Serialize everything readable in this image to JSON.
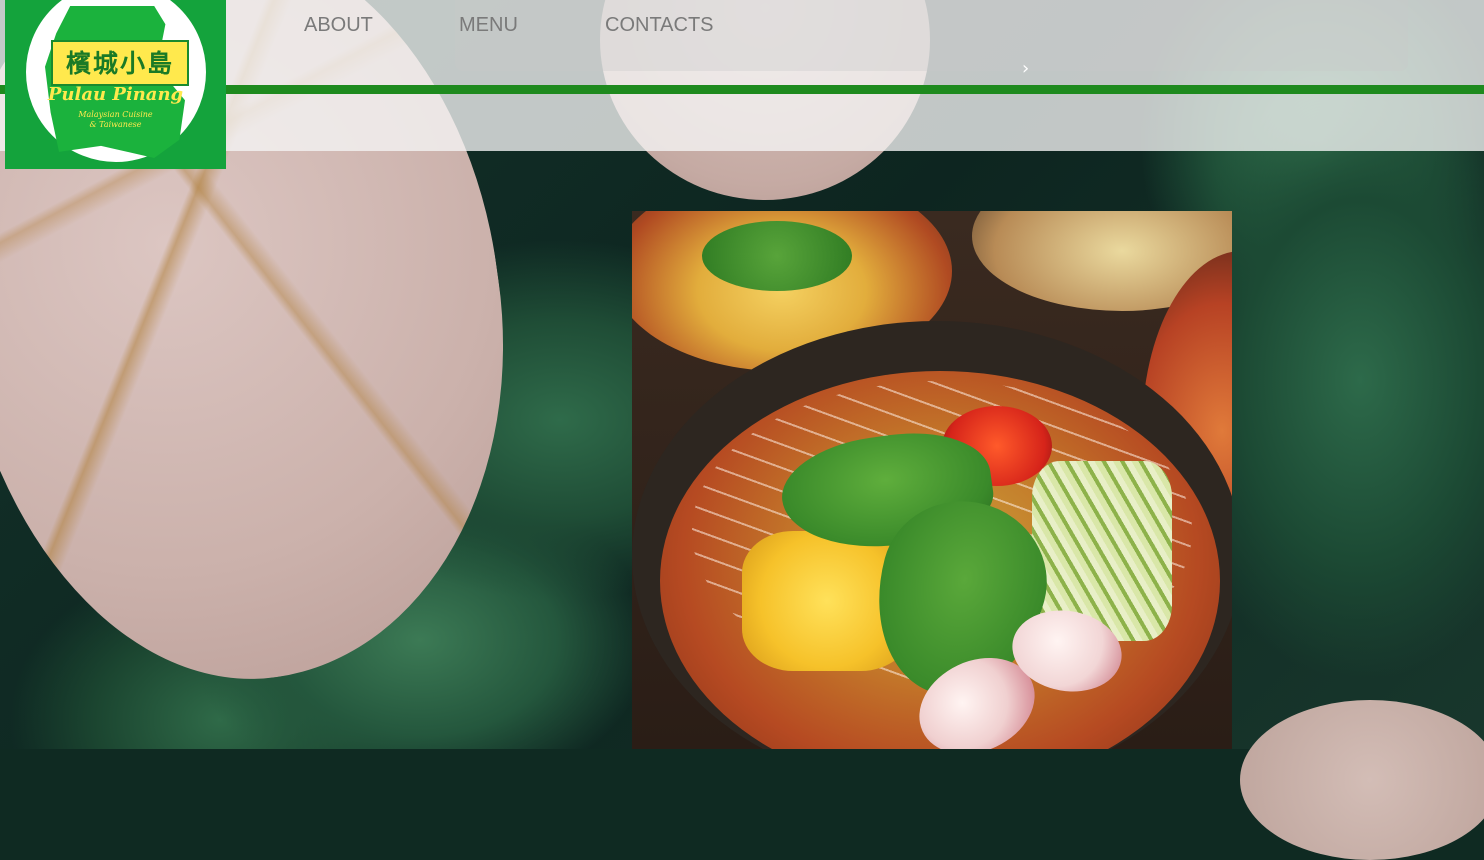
{
  "brand": {
    "name_cn": "檳城小島",
    "name_en": "Pulau Pinang",
    "tagline_line1": "Malaysian Cuisine",
    "tagline_line2": "& Taiwanese"
  },
  "nav": {
    "items": [
      {
        "label": "ABOUT"
      },
      {
        "label": "MENU"
      },
      {
        "label": "CONTACTS"
      }
    ]
  },
  "colors": {
    "brand_green": "#14a33c",
    "rule_green": "#1e8a1e",
    "logo_yellow": "#ffe94d",
    "nav_text": "#7a7a7a"
  },
  "icons": {
    "slider_next": "chevron-right-icon"
  }
}
